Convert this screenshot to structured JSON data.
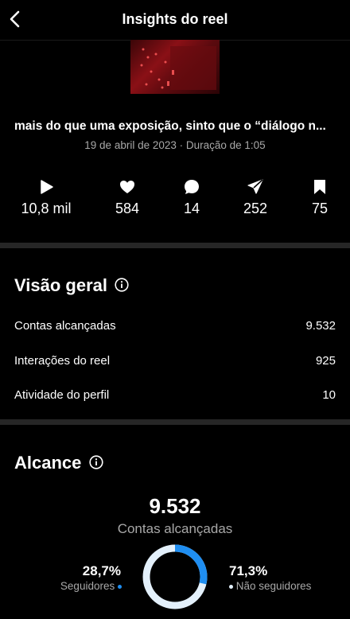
{
  "header": {
    "title": "Insights do reel"
  },
  "post": {
    "caption": "mais do que uma exposição, sinto que o “diálogo n...",
    "meta": "19 de abril de 2023 · Duração de 1:05"
  },
  "stats": [
    {
      "icon": "play-icon",
      "value": "10,8 mil"
    },
    {
      "icon": "heart-icon",
      "value": "584"
    },
    {
      "icon": "comment-icon",
      "value": "14"
    },
    {
      "icon": "share-icon",
      "value": "252"
    },
    {
      "icon": "bookmark-icon",
      "value": "75"
    }
  ],
  "overview": {
    "title": "Visão geral",
    "rows": [
      {
        "label": "Contas alcançadas",
        "value": "9.532"
      },
      {
        "label": "Interações do reel",
        "value": "925"
      },
      {
        "label": "Atividade do perfil",
        "value": "10"
      }
    ]
  },
  "reach": {
    "title": "Alcance",
    "total": "9.532",
    "total_label": "Contas alcançadas",
    "followers_pct": "28,7%",
    "followers_label": "Seguidores",
    "non_followers_pct": "71,3%",
    "non_followers_label": "Não seguidores",
    "followers_fraction": 0.287,
    "colors": {
      "followers": "#1f8ef1",
      "non_followers": "#e3f0fb"
    }
  }
}
